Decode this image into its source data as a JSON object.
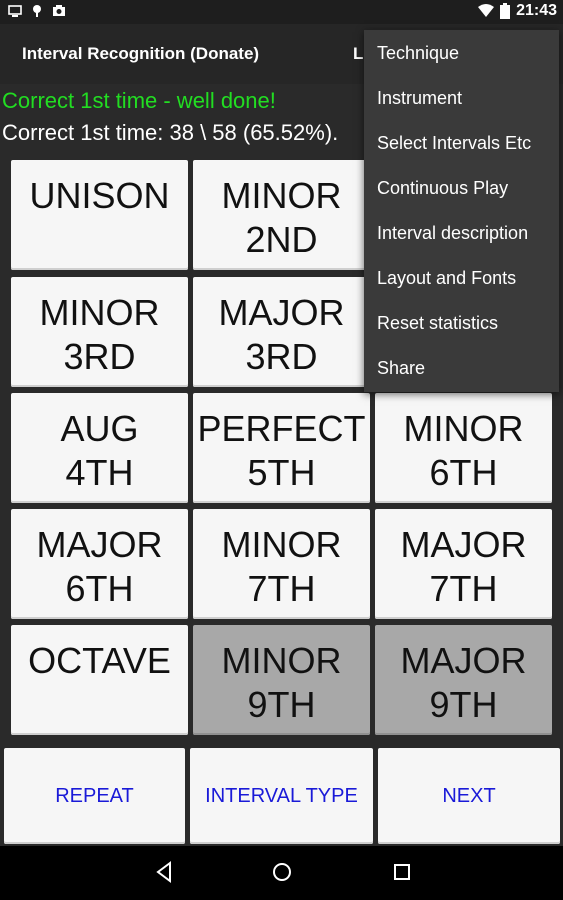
{
  "status_bar": {
    "icons_left": [
      "screen-icon",
      "notification-icon",
      "photo-icon"
    ],
    "icons_right": [
      "wifi-icon",
      "battery-icon"
    ],
    "time": "21:43"
  },
  "app_bar": {
    "title": "Interval Recognition (Donate)",
    "truncated_label": "L"
  },
  "feedback": {
    "message": "Correct 1st time - well done!",
    "stats": "Correct 1st time: 38 \\ 58 (65.52%)."
  },
  "intervals": {
    "unison": "UNISON",
    "minor_2nd": "MINOR\n2ND",
    "minor_3rd": "MINOR\n3RD",
    "major_3rd": "MAJOR\n3RD",
    "aug_4th": "AUG\n4TH",
    "perfect_5th": "PERFECT\n5TH",
    "minor_6th": "MINOR\n6TH",
    "major_6th": "MAJOR\n6TH",
    "minor_7th": "MINOR\n7TH",
    "major_7th": "MAJOR\n7TH",
    "octave": "OCTAVE",
    "minor_9th": "MINOR\n9TH",
    "major_9th": "MAJOR\n9TH"
  },
  "actions": {
    "repeat": "REPEAT",
    "interval_type": "INTERVAL TYPE",
    "next": "NEXT"
  },
  "menu": {
    "items": [
      "Technique",
      "Instrument",
      "Select Intervals Etc",
      "Continuous Play",
      "Interval description",
      "Layout and Fonts",
      "Reset statistics",
      "Share"
    ]
  },
  "nav_bar": {
    "icons": [
      "back-icon",
      "home-icon",
      "recents-icon"
    ]
  },
  "colors": {
    "feedback_green": "#22dd22",
    "action_text_blue": "#1a1ad8",
    "button_bg": "#f6f6f6",
    "button_disabled_bg": "#a8a8a8",
    "menu_bg": "#3a3a3a"
  }
}
